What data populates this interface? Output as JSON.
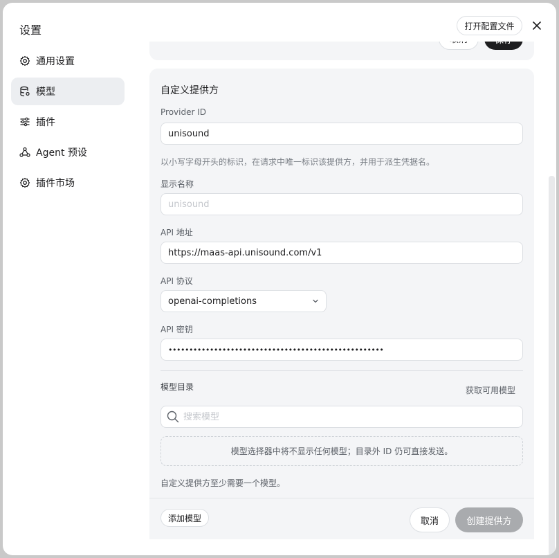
{
  "window": {
    "title": "设置"
  },
  "header": {
    "open_config_label": "打开配置文件"
  },
  "sidebar": {
    "items": [
      {
        "label": "通用设置",
        "icon": "gear-icon",
        "active": false
      },
      {
        "label": "模型",
        "icon": "database-icon",
        "active": true
      },
      {
        "label": "插件",
        "icon": "sliders-icon",
        "active": false
      },
      {
        "label": "Agent 预设",
        "icon": "nodes-icon",
        "active": false
      },
      {
        "label": "插件市场",
        "icon": "gear-icon",
        "active": false
      }
    ]
  },
  "prev_card": {
    "cancel_label": "取消",
    "save_label": "保存"
  },
  "form": {
    "title": "自定义提供方",
    "provider_id": {
      "label": "Provider ID",
      "value": "unisound",
      "hint": "以小写字母开头的标识，在请求中唯一标识该提供方，并用于派生凭据名。"
    },
    "display_name": {
      "label": "显示名称",
      "placeholder": "unisound"
    },
    "api_url": {
      "label": "API 地址",
      "value": "https://maas-api.unisound.com/v1"
    },
    "api_protocol": {
      "label": "API 协议",
      "value": "openai-completions"
    },
    "api_key": {
      "label": "API 密钥",
      "value": "••••••••••••••••••••••••••••••••••••••••••••••••••••"
    },
    "catalog": {
      "label": "模型目录",
      "fetch_label": "获取可用模型",
      "search_placeholder": "搜索模型",
      "empty_text": "模型选择器中将不显示任何模型；目录外 ID 仍可直接发送。",
      "requirement_hint": "自定义提供方至少需要一个模型。"
    }
  },
  "footer": {
    "add_model_label": "添加模型",
    "cancel_label": "取消",
    "create_label": "创建提供方"
  }
}
